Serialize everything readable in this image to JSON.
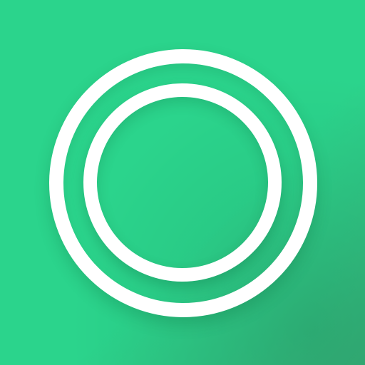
{
  "icon": {
    "name": "concentric-rings-icon",
    "background_color": "#2bd48c",
    "background_shade_color": "#34b47a",
    "ring_color": "#ffffff"
  }
}
